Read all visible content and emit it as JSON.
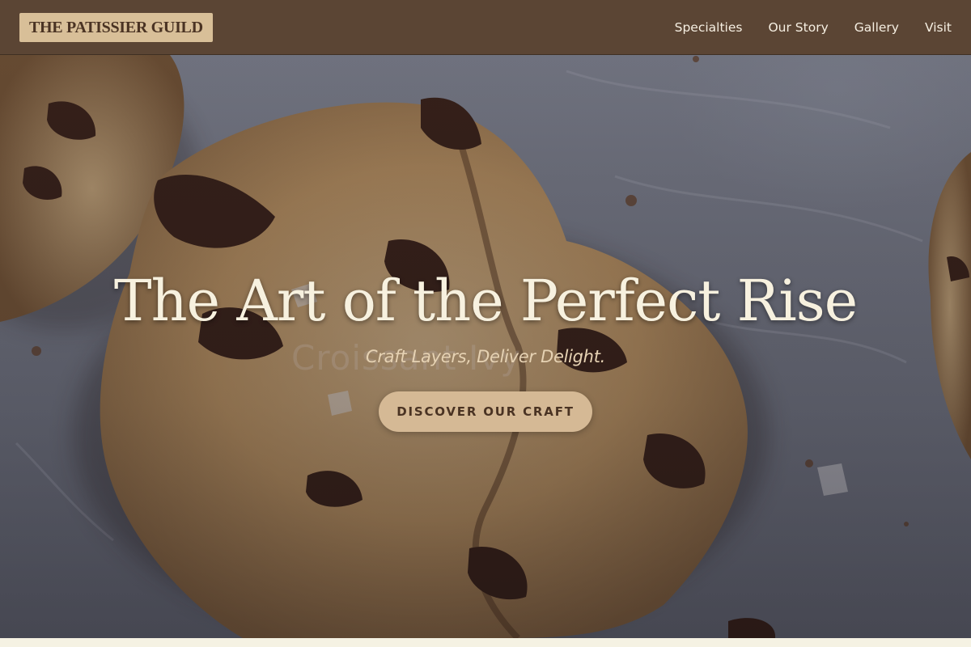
{
  "brand": {
    "logo_text": "THE PATISSIER GUILD"
  },
  "nav": {
    "items": [
      {
        "label": "Specialties"
      },
      {
        "label": "Our Story"
      },
      {
        "label": "Gallery"
      },
      {
        "label": "Visit"
      }
    ]
  },
  "hero": {
    "title": "The Art of the Perfect Rise",
    "subtitle": "Craft Layers, Deliver Delight.",
    "ghost_text": "Croissant Ivy",
    "cta_label": "DISCOVER OUR CRAFT",
    "background_subject": "chocolate chip cookies on parchment"
  },
  "colors": {
    "nav_background": "#5b4534",
    "logo_background": "#d8bf98",
    "accent": "#d5b995",
    "title_text": "#f7f1df",
    "subtitle_text": "#e6d2b3",
    "page_background": "#f6f3e4"
  }
}
